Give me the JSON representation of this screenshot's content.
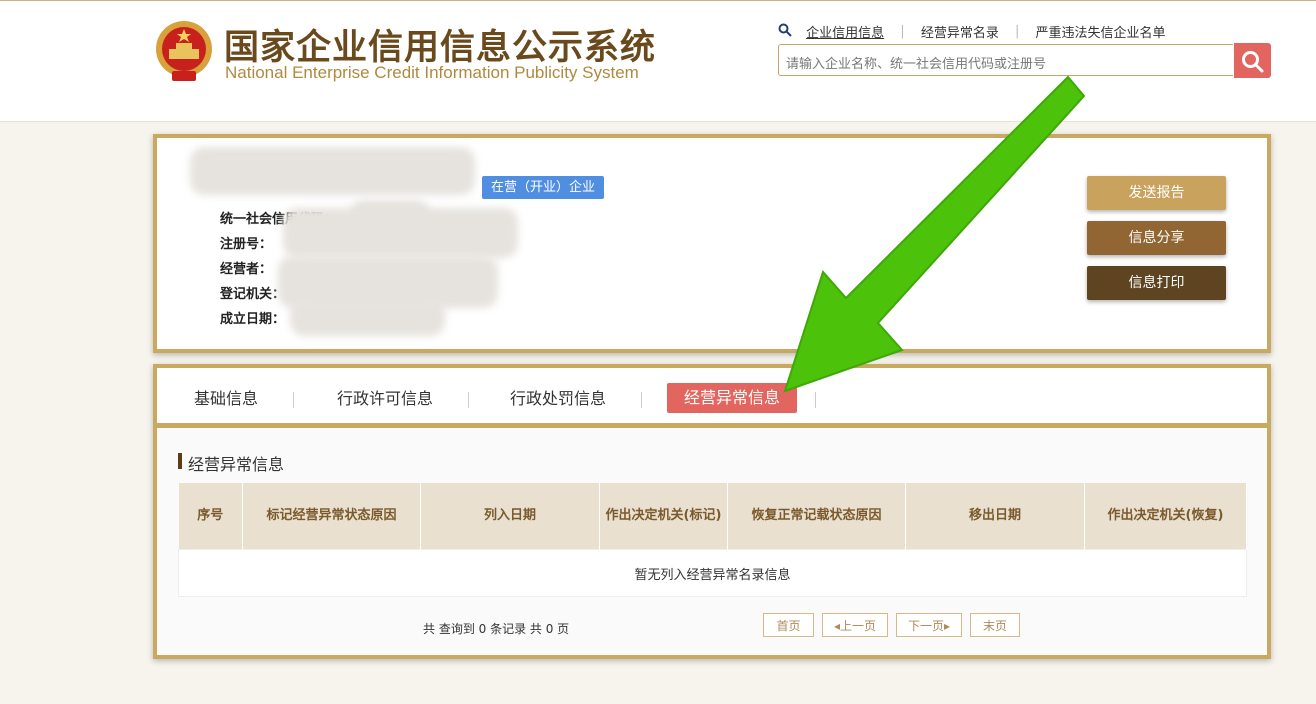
{
  "header": {
    "logo_cn": "国家企业信用信息公示系统",
    "logo_en": "National Enterprise Credit Information Publicity System",
    "links": [
      "企业信用信息",
      "经营异常名录",
      "严重违法失信企业名单"
    ],
    "search_placeholder": "请输入企业名称、统一社会信用代码或注册号"
  },
  "company": {
    "status_badge": "在营（开业）企业",
    "fields": [
      "统一社会信用代码：",
      "注册号：",
      "经营者：",
      "登记机关：",
      "成立日期："
    ]
  },
  "actions": {
    "send_report": "发送报告",
    "share": "信息分享",
    "print": "信息打印"
  },
  "tabs": [
    "基础信息",
    "行政许可信息",
    "行政处罚信息",
    "经营异常信息"
  ],
  "section": {
    "title": "经营异常信息",
    "columns": [
      "序号",
      "标记经营异常状态原因",
      "列入日期",
      "作出决定机关(标记)",
      "恢复正常记载状态原因",
      "移出日期",
      "作出决定机关(恢复)"
    ],
    "empty_text": "暂无列入经营异常名录信息"
  },
  "pager": {
    "summary": "共 查询到 0 条记录 共 0 页",
    "first": "首页",
    "prev": "上一页",
    "next": "下一页",
    "last": "末页"
  },
  "colors": {
    "accent_gold": "#c9a85f",
    "active_red": "#e3655f",
    "arrow_green": "#4cc20a"
  }
}
